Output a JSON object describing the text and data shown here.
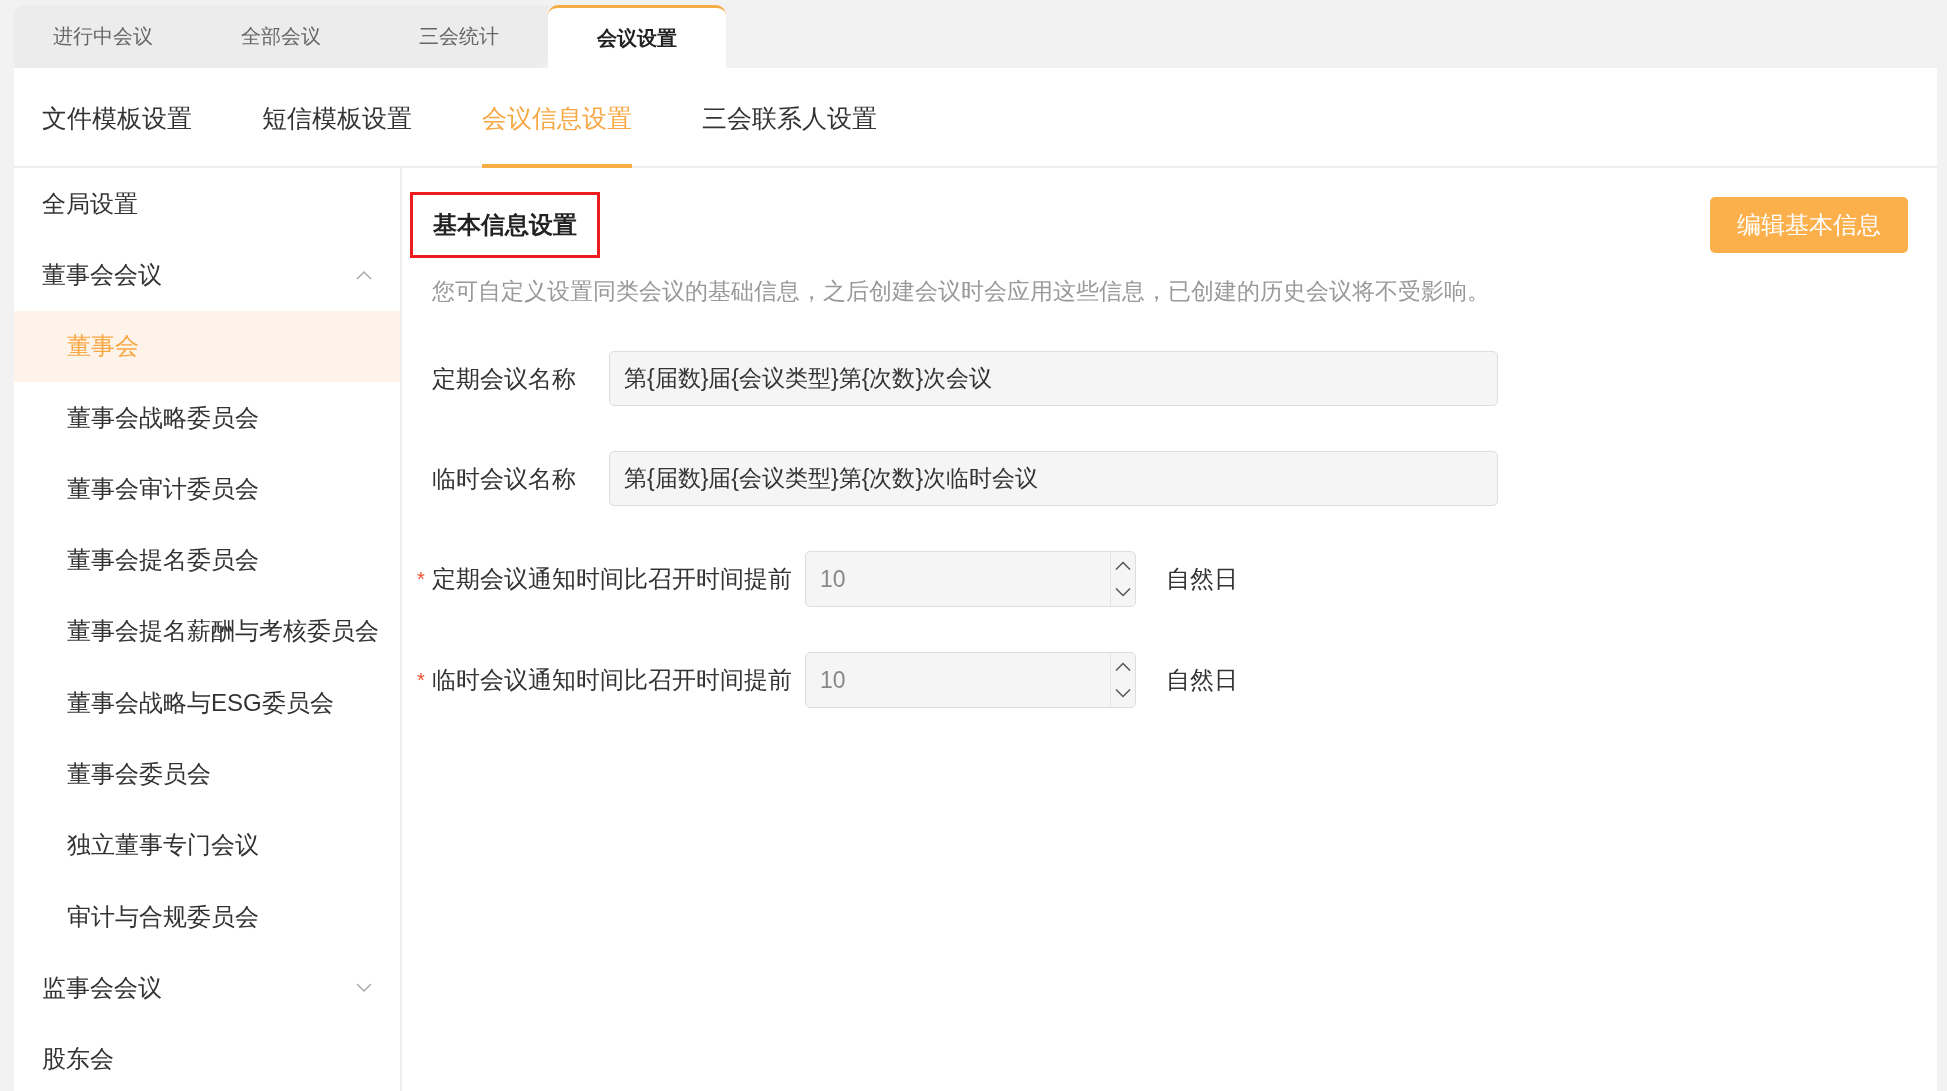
{
  "top_tabs": [
    {
      "label": "进行中会议",
      "selected": false
    },
    {
      "label": "全部会议",
      "selected": false
    },
    {
      "label": "三会统计",
      "selected": false
    },
    {
      "label": "会议设置",
      "selected": true
    }
  ],
  "sub_tabs": [
    {
      "label": "文件模板设置",
      "selected": false
    },
    {
      "label": "短信模板设置",
      "selected": false
    },
    {
      "label": "会议信息设置",
      "selected": true
    },
    {
      "label": "三会联系人设置",
      "selected": false
    }
  ],
  "sidebar": {
    "items": [
      {
        "label": "全局设置",
        "kind": "item",
        "selected": false
      },
      {
        "label": "董事会会议",
        "kind": "group",
        "expanded": true,
        "children": [
          {
            "label": "董事会",
            "selected": true
          },
          {
            "label": "董事会战略委员会",
            "selected": false
          },
          {
            "label": "董事会审计委员会",
            "selected": false
          },
          {
            "label": "董事会提名委员会",
            "selected": false
          },
          {
            "label": "董事会提名薪酬与考核委员会",
            "selected": false
          },
          {
            "label": "董事会战略与ESG委员会",
            "selected": false
          },
          {
            "label": "董事会委员会",
            "selected": false
          },
          {
            "label": "独立董事专门会议",
            "selected": false
          },
          {
            "label": "审计与合规委员会",
            "selected": false
          }
        ]
      },
      {
        "label": "监事会会议",
        "kind": "group",
        "expanded": false
      },
      {
        "label": "股东会",
        "kind": "item",
        "selected": false
      }
    ]
  },
  "panel": {
    "title": "基本信息设置",
    "title_highlighted": true,
    "edit_button": "编辑基本信息",
    "description": "您可自定义设置同类会议的基础信息，之后创建会议时会应用这些信息，已创建的历史会议将不受影响。",
    "fields": [
      {
        "kind": "text",
        "label": "定期会议名称",
        "value": "第{届数}届{会议类型}第{次数}次会议"
      },
      {
        "kind": "text",
        "label": "临时会议名称",
        "value": "第{届数}届{会议类型}第{次数}次临时会议"
      },
      {
        "kind": "number",
        "required_mark": "*",
        "label": "定期会议通知时间比召开时间提前",
        "value": "10",
        "unit": "自然日"
      },
      {
        "kind": "number",
        "required_mark": "*",
        "label": "临时会议通知时间比召开时间提前",
        "value": "10",
        "unit": "自然日"
      }
    ]
  }
}
